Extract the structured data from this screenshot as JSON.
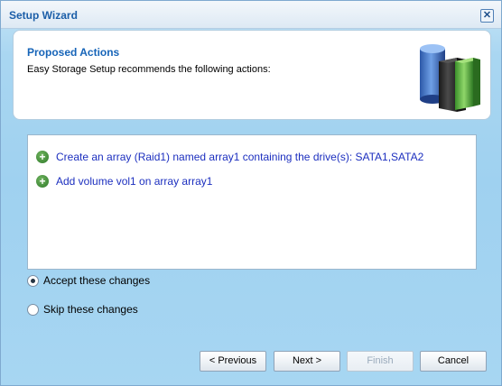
{
  "window": {
    "title": "Setup Wizard",
    "close_label": "✕"
  },
  "header": {
    "title": "Proposed Actions",
    "subtitle": "Easy Storage Setup recommends the following actions:",
    "icon": "storage-server-icon"
  },
  "actions": [
    {
      "icon": "add-icon",
      "text": "Create an array (Raid1) named array1 containing the drive(s): SATA1,SATA2"
    },
    {
      "icon": "add-icon",
      "text": "Add volume vol1 on array array1"
    }
  ],
  "options": {
    "accept_label": "Accept these changes",
    "skip_label": "Skip these changes",
    "selected": "accept"
  },
  "buttons": {
    "previous": "< Previous",
    "next": "Next >",
    "finish": "Finish",
    "cancel": "Cancel",
    "finish_enabled": false
  },
  "colors": {
    "accent": "#1664b8",
    "action_text": "#1c2fbf",
    "background": "#a9d6f1",
    "plus_icon": "#3f8a35"
  }
}
